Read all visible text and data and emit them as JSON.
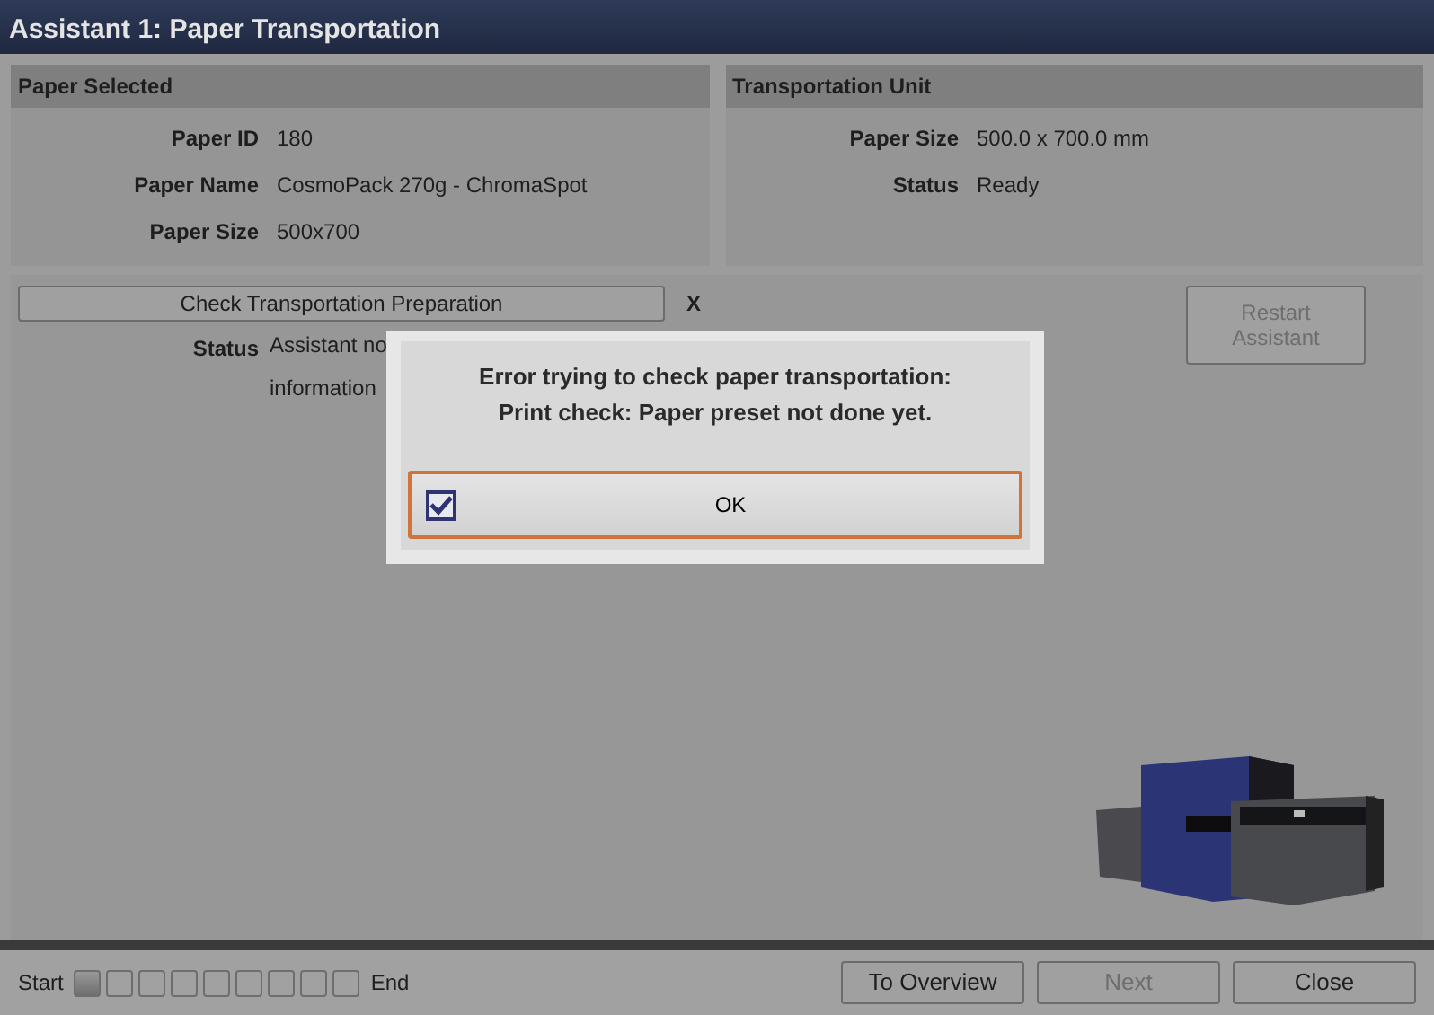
{
  "window": {
    "title": "Assistant 1: Paper Transportation"
  },
  "paper_selected": {
    "title": "Paper Selected",
    "fields": [
      {
        "label": "Paper ID",
        "value": "180"
      },
      {
        "label": "Paper Name",
        "value": "CosmoPack 270g - ChromaSpot"
      },
      {
        "label": "Paper Size",
        "value": "500x700"
      }
    ]
  },
  "transportation_unit": {
    "title": "Transportation Unit",
    "fields": [
      {
        "label": "Paper Size",
        "value": "500.0 x 700.0 mm"
      },
      {
        "label": "Status",
        "value": "Ready"
      }
    ]
  },
  "check": {
    "button": "Check Transportation Preparation",
    "mark": "X",
    "status_label": "Status",
    "status_lines": [
      "Assistant no",
      "information"
    ]
  },
  "restart_button": {
    "label": "Restart\nAssistant",
    "disabled": true
  },
  "dialog": {
    "lines": [
      "Error trying to check paper transportation:",
      "Print check: Paper preset not done yet."
    ],
    "ok": {
      "label": "OK",
      "checked": true
    }
  },
  "footer": {
    "start": "Start",
    "end": "End",
    "steps": [
      {
        "selected": true
      },
      {
        "selected": false
      },
      {
        "selected": false
      },
      {
        "selected": false
      },
      {
        "selected": false
      },
      {
        "selected": false
      },
      {
        "selected": false
      },
      {
        "selected": false
      },
      {
        "selected": false
      }
    ],
    "buttons": [
      {
        "label": "To Overview",
        "disabled": false
      },
      {
        "label": "Next",
        "disabled": true
      },
      {
        "label": "Close",
        "disabled": false
      }
    ]
  }
}
